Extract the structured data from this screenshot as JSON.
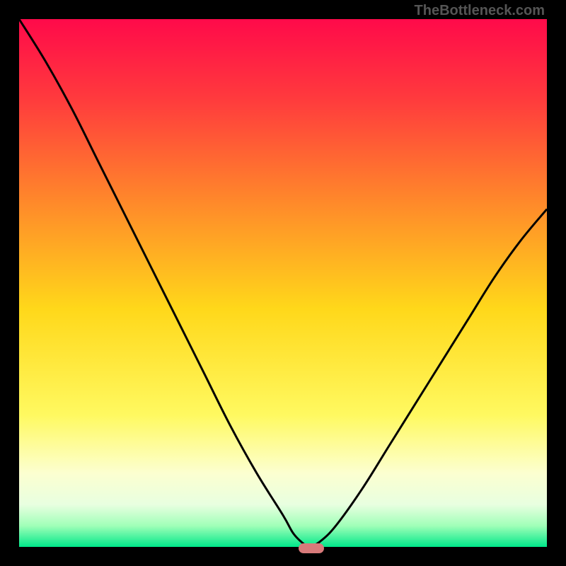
{
  "watermark": "TheBottleneck.com",
  "chart_data": {
    "type": "line",
    "title": "",
    "xlabel": "",
    "ylabel": "",
    "x": [
      0.0,
      0.05,
      0.1,
      0.15,
      0.2,
      0.25,
      0.3,
      0.35,
      0.4,
      0.45,
      0.5,
      0.52,
      0.54,
      0.55,
      0.57,
      0.6,
      0.65,
      0.7,
      0.75,
      0.8,
      0.85,
      0.9,
      0.95,
      1.0
    ],
    "values": [
      1.0,
      0.92,
      0.83,
      0.73,
      0.63,
      0.53,
      0.43,
      0.33,
      0.23,
      0.14,
      0.06,
      0.025,
      0.005,
      0.0,
      0.01,
      0.04,
      0.11,
      0.19,
      0.27,
      0.35,
      0.43,
      0.51,
      0.58,
      0.64
    ],
    "ylim": [
      0,
      1
    ],
    "xlim": [
      0,
      1
    ],
    "bottleneck_marker": {
      "x": 0.55,
      "y": 0.0
    },
    "gradient_stops": [
      {
        "pos": 0.0,
        "color": "#ff0a4a"
      },
      {
        "pos": 0.15,
        "color": "#ff3a3d"
      },
      {
        "pos": 0.35,
        "color": "#ff8a2a"
      },
      {
        "pos": 0.55,
        "color": "#ffd81a"
      },
      {
        "pos": 0.75,
        "color": "#fff960"
      },
      {
        "pos": 0.86,
        "color": "#fcffd0"
      },
      {
        "pos": 0.92,
        "color": "#e8ffe0"
      },
      {
        "pos": 0.96,
        "color": "#a0ffb8"
      },
      {
        "pos": 1.0,
        "color": "#00e88a"
      }
    ]
  }
}
